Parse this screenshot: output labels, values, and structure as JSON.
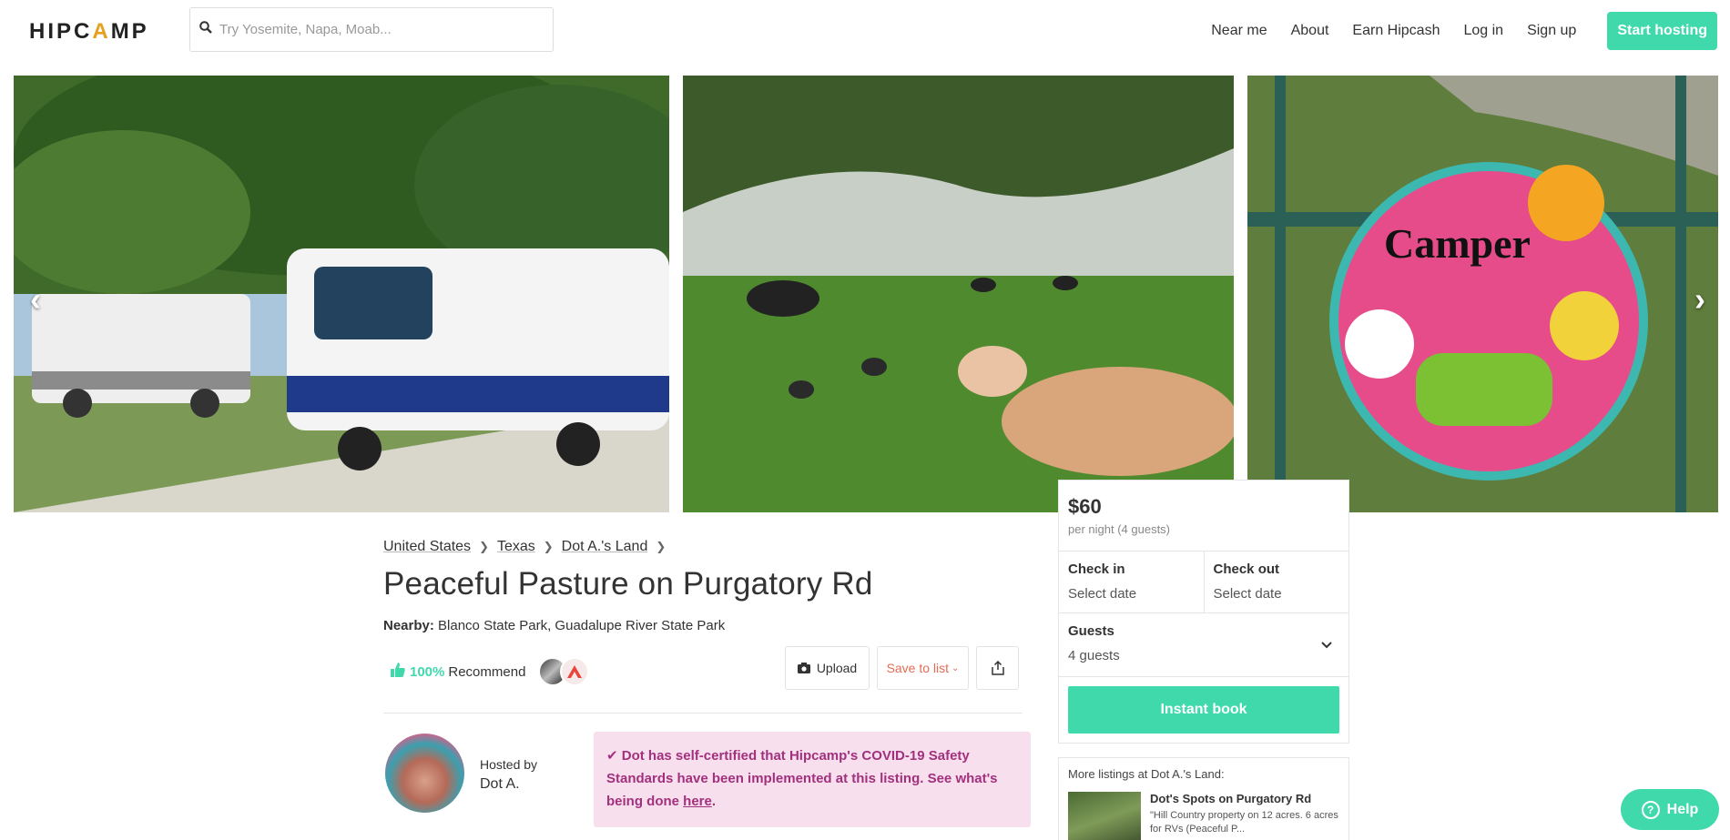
{
  "header": {
    "logo": "HIPCAMP",
    "search_placeholder": "Try Yosemite, Napa, Moab...",
    "nav": [
      "Near me",
      "About",
      "Earn Hipcash",
      "Log in",
      "Sign up"
    ],
    "start_hosting": "Start hosting"
  },
  "breadcrumb": [
    "United States",
    "Texas",
    "Dot A.'s Land"
  ],
  "listing": {
    "title": "Peaceful Pasture on Purgatory Rd",
    "nearby_label": "Nearby:",
    "nearby": "Blanco State Park, Guadalupe River State Park",
    "recommend_pct": "100%",
    "recommend_label": "Recommend"
  },
  "actions": {
    "upload": "Upload",
    "save": "Save to list"
  },
  "host": {
    "hosted_by": "Hosted by",
    "name": "Dot A."
  },
  "covid": {
    "text": "Dot has self-certified that Hipcamp's COVID-19 Safety Standards have been implemented at this listing. See what's being done ",
    "link": "here",
    "end": "."
  },
  "booking": {
    "price": "$60",
    "per": "per night (4 guests)",
    "checkin_label": "Check in",
    "checkin_value": "Select date",
    "checkout_label": "Check out",
    "checkout_value": "Select date",
    "guests_label": "Guests",
    "guests_value": "4 guests",
    "instant_book": "Instant book"
  },
  "more": {
    "heading": "More listings at Dot A.'s Land:",
    "item_name": "Dot's Spots on Purgatory Rd",
    "item_desc": "\"Hill Country property on 12 acres. 6 acres for RVs (Peaceful P..."
  },
  "help": "Help",
  "colors": {
    "accent": "#40d9ac",
    "save": "#e56b57",
    "covid_text": "#a2317d",
    "covid_bg": "#f7dfee"
  }
}
